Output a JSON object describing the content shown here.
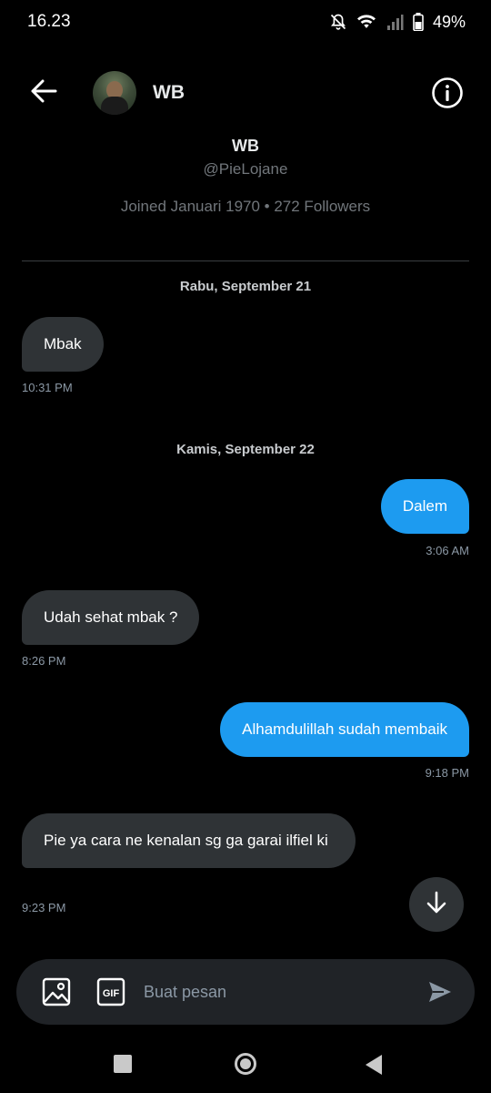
{
  "status_bar": {
    "time": "16.23",
    "battery": "49%"
  },
  "header": {
    "name": "WB"
  },
  "profile": {
    "name": "WB",
    "handle": "@PieLojane",
    "meta": "Joined Januari 1970 • 272 Followers"
  },
  "conversation": {
    "dates": [
      "Rabu, September 21",
      "Kamis, September 22"
    ],
    "messages": [
      {
        "direction": "in",
        "text": "Mbak",
        "time": "10:31 PM"
      },
      {
        "direction": "out",
        "text": "Dalem",
        "time": "3:06 AM"
      },
      {
        "direction": "in",
        "text": "Udah sehat mbak ?",
        "time": "8:26 PM"
      },
      {
        "direction": "out",
        "text": "Alhamdulillah sudah membaik",
        "time": "9:18 PM"
      },
      {
        "direction": "in",
        "text": "Pie ya cara ne kenalan sg ga garai ilfiel ki",
        "time": "9:23 PM"
      }
    ]
  },
  "composer": {
    "placeholder": "Buat pesan",
    "value": "",
    "gif_label": "GIF"
  },
  "colors": {
    "background": "#000000",
    "incoming_bubble": "#2f3336",
    "outgoing_bubble": "#1d9bf0",
    "secondary_text": "#71767b"
  },
  "icons": [
    "back-arrow-icon",
    "info-icon",
    "scroll-down-arrow-icon",
    "image-icon",
    "gif-icon",
    "send-icon",
    "wifi-icon",
    "signal-icon",
    "battery-icon",
    "notifications-off-icon"
  ]
}
